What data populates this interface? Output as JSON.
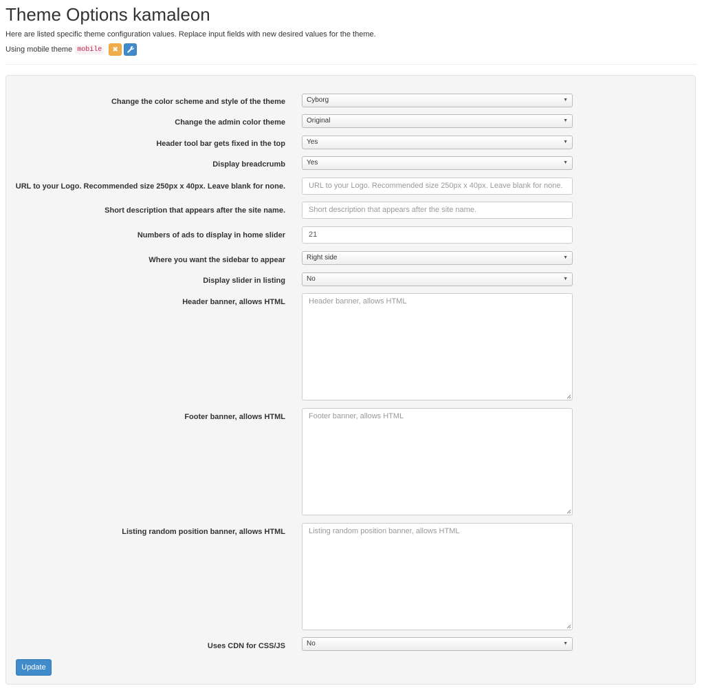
{
  "header": {
    "title": "Theme Options kamaleon",
    "intro": "Here are listed specific theme configuration values. Replace input fields with new desired values for the theme.",
    "mobile_prefix": "Using mobile theme",
    "mobile_theme": "mobile",
    "remove_icon": "close-icon",
    "configure_icon": "wrench-icon"
  },
  "form": {
    "color_scheme": {
      "label": "Change the color scheme and style of the theme",
      "value": "Cyborg"
    },
    "admin_color": {
      "label": "Change the admin color theme",
      "value": "Original"
    },
    "fixed_toolbar": {
      "label": "Header tool bar gets fixed in the top",
      "value": "Yes"
    },
    "breadcrumb": {
      "label": "Display breadcrumb",
      "value": "Yes"
    },
    "logo_url": {
      "label": "URL to your Logo. Recommended size 250px x 40px. Leave blank for none.",
      "placeholder": "URL to your Logo. Recommended size 250px x 40px. Leave blank for none."
    },
    "short_desc": {
      "label": "Short description that appears after the site name.",
      "placeholder": "Short description that appears after the site name."
    },
    "ads_count": {
      "label": "Numbers of ads to display in home slider",
      "value": "21"
    },
    "sidebar": {
      "label": "Where you want the sidebar to appear",
      "value": "Right side"
    },
    "listing_slider": {
      "label": "Display slider in listing",
      "value": "No"
    },
    "header_banner": {
      "label": "Header banner, allows HTML",
      "placeholder": "Header banner, allows HTML"
    },
    "footer_banner": {
      "label": "Footer banner, allows HTML",
      "placeholder": "Footer banner, allows HTML"
    },
    "listing_banner": {
      "label": "Listing random position banner, allows HTML",
      "placeholder": "Listing random position banner, allows HTML"
    },
    "cdn": {
      "label": "Uses CDN for CSS/JS",
      "value": "No"
    },
    "submit_label": "Update"
  }
}
